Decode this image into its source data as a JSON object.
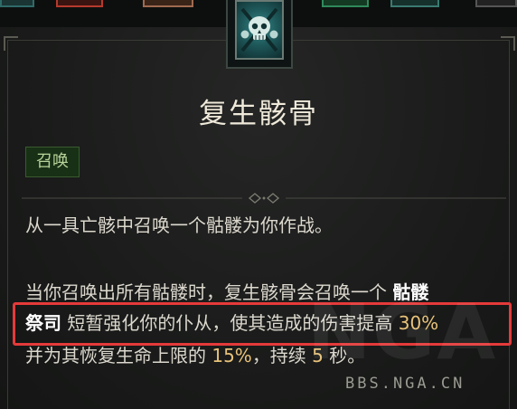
{
  "skill": {
    "name": "复生骸骨",
    "tag": "召唤",
    "desc_line1": "从一具亡骸中召唤一个骷髅为你作战。",
    "desc_line2_part1": "当你召唤出所有骷髅时，复生骸骨会召唤一个",
    "desc_line2_hl": "骷髅",
    "desc_line3_hl": "祭司",
    "desc_line3_part": "短暂强化你的仆从，使其造成的伤害提高",
    "desc_line3_num": "30%",
    "desc_line4_part1": "并为其恢复生命上限的",
    "desc_line4_num1": "15%",
    "desc_line4_part2": "，持续",
    "desc_line4_num2": "5",
    "desc_line4_part3": "秒。"
  },
  "icon": {
    "name": "skull-icon"
  },
  "watermark": {
    "text": "BBS.NGA.CN",
    "big_text": "NGA"
  },
  "colors": {
    "highlight_box": "#e53a3a",
    "number": "#e8c27a",
    "tag_bg": "#183015"
  }
}
